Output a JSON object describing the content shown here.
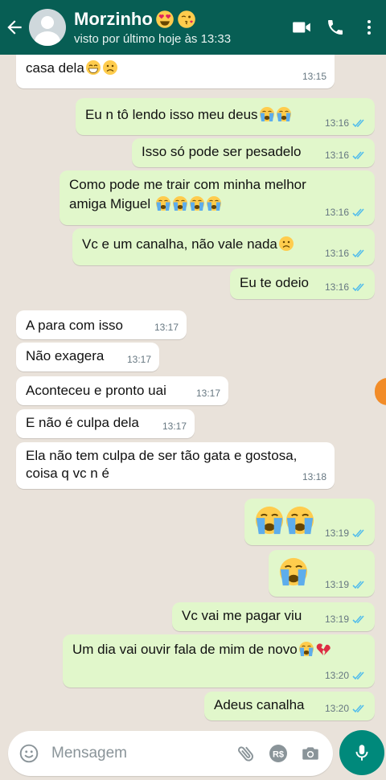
{
  "header": {
    "contact_name": "Morzinho",
    "status": "visto por último hoje às 13:33",
    "back_icon": "arrow-left-icon",
    "icons": [
      "video-call-icon",
      "phone-icon",
      "more-vert-icon"
    ],
    "name_emojis": [
      "heart-eyes-emoji",
      "kiss-emoji"
    ]
  },
  "messages": [
    {
      "dir": "in",
      "text": "casa dela",
      "time": "13:15",
      "emojis": [
        "grin-emoji",
        "frown-emoji"
      ]
    },
    {
      "dir": "out",
      "text": "Eu n tô lendo isso meu deus",
      "time": "13:16",
      "emojis": [
        "crying-emoji",
        "crying-emoji"
      ]
    },
    {
      "dir": "out",
      "text": "Isso só pode ser pesadelo",
      "time": "13:16",
      "emojis": []
    },
    {
      "dir": "out",
      "text": "Como pode me trair com minha melhor",
      "text2": "amiga Miguel",
      "time": "13:16",
      "emojis": [
        "crying-emoji",
        "crying-emoji",
        "crying-emoji",
        "crying-emoji"
      ]
    },
    {
      "dir": "out",
      "text": "Vc e um canalha, não vale nada",
      "time": "13:16",
      "emojis": [
        "frown-emoji"
      ]
    },
    {
      "dir": "out",
      "text": "Eu te odeio",
      "time": "13:16",
      "emojis": []
    },
    {
      "dir": "in",
      "text": "A para  com isso",
      "time": "13:17",
      "emojis": []
    },
    {
      "dir": "in",
      "text": "Não exagera",
      "time": "13:17",
      "emojis": []
    },
    {
      "dir": "in",
      "text": "Aconteceu e pronto uai",
      "time": "13:17",
      "emojis": []
    },
    {
      "dir": "in",
      "text": "E não é culpa dela",
      "time": "13:17",
      "emojis": []
    },
    {
      "dir": "in",
      "text": "Ela não tem culpa de ser tão gata e gostosa,",
      "text2": "coisa q vc n é",
      "time": "13:18",
      "emojis": []
    },
    {
      "dir": "out",
      "text": "",
      "time": "13:19",
      "emojis": [
        "crying-emoji",
        "crying-emoji"
      ]
    },
    {
      "dir": "out",
      "text": "",
      "time": "13:19",
      "emojis": [
        "crying-emoji"
      ]
    },
    {
      "dir": "out",
      "text": "Vc vai me pagar viu",
      "time": "13:19",
      "emojis": []
    },
    {
      "dir": "out",
      "text": "Um dia vai ouvir fala de mim de novo",
      "time": "13:20",
      "emojis": [
        "crying-emoji",
        "broken-heart-emoji"
      ]
    },
    {
      "dir": "out",
      "text": "Adeus canalha",
      "time": "13:20",
      "emojis": []
    }
  ],
  "input": {
    "placeholder": "Mensagem",
    "icons": [
      "emoji-icon",
      "attach-icon",
      "payment-icon",
      "camera-icon"
    ],
    "send_icon": "mic-icon"
  },
  "colors": {
    "header_bg": "#075e54",
    "outgoing_bubble": "#e1f7cb",
    "incoming_bubble": "#ffffff",
    "read_ticks": "#53bdeb",
    "mic_button": "#00897b"
  }
}
